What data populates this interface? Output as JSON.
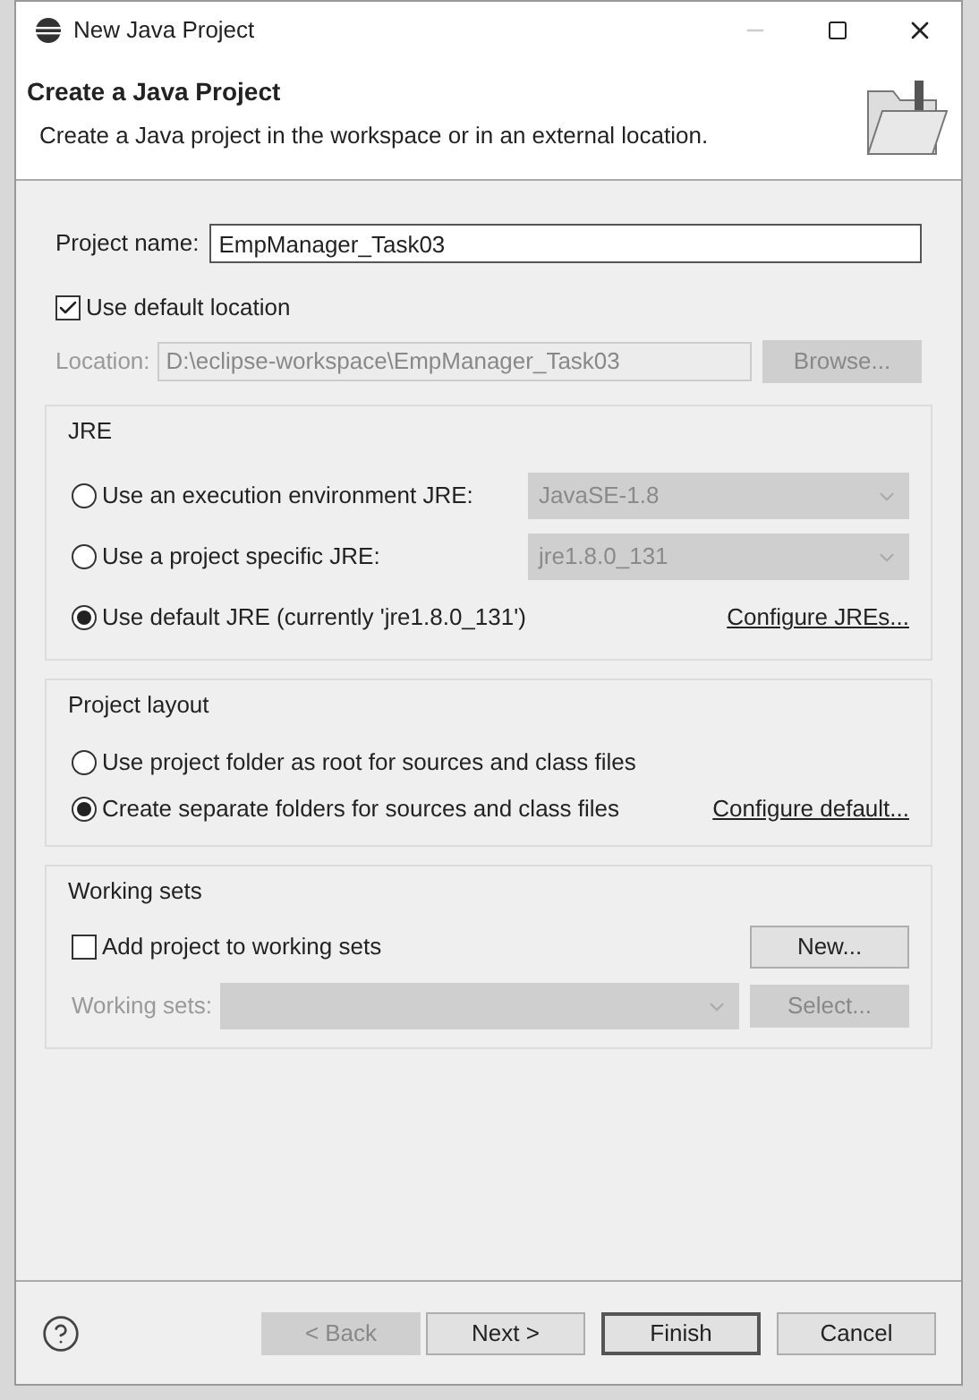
{
  "window": {
    "title": "New Java Project"
  },
  "header": {
    "title": "Create a Java Project",
    "description": "Create a Java project in the workspace or in an external location."
  },
  "project_name": {
    "label": "Project name:",
    "value": "EmpManager_Task03"
  },
  "default_location": {
    "label": "Use default location",
    "checked": true
  },
  "location": {
    "label": "Location:",
    "value": "D:\\eclipse-workspace\\EmpManager_Task03",
    "disabled": true,
    "button": "Browse...",
    "button_disabled": true
  },
  "jre": {
    "title": "JRE",
    "options": [
      {
        "label": "Use an execution environment JRE:",
        "selected": false,
        "dropdown": "JavaSE-1.8"
      },
      {
        "label": "Use a project specific JRE:",
        "selected": false,
        "dropdown": "jre1.8.0_131"
      },
      {
        "label": "Use default JRE (currently 'jre1.8.0_131')",
        "selected": true,
        "link": "Configure JREs..."
      }
    ]
  },
  "project_layout": {
    "title": "Project layout",
    "options": [
      {
        "label": "Use project folder as root for sources and class files",
        "selected": false
      },
      {
        "label": "Create separate folders for sources and class files",
        "selected": true,
        "link": "Configure default..."
      }
    ]
  },
  "working_sets": {
    "title": "Working sets",
    "checkbox": {
      "label": "Add project to working sets",
      "checked": false
    },
    "new_button": "New...",
    "field_label": "Working sets:",
    "select_button": "Select...",
    "disabled": true
  },
  "buttons": [
    {
      "label": "< Back",
      "disabled": true,
      "default": false
    },
    {
      "label": "Next >",
      "disabled": false,
      "default": false
    },
    {
      "label": "Finish",
      "disabled": false,
      "default": true
    },
    {
      "label": "Cancel",
      "disabled": false,
      "default": false
    }
  ]
}
